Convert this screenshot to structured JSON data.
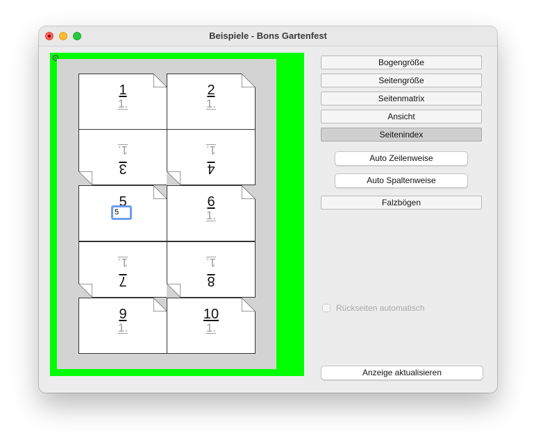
{
  "window": {
    "title": "Beispiele - Bons Gartenfest"
  },
  "preview": {
    "background_color": "#00ff00",
    "sheet_color": "#d3d3d3",
    "settings_icon": "gear-icon",
    "pages": [
      {
        "number": "1",
        "sub": "1.",
        "orientation": "up"
      },
      {
        "number": "2",
        "sub": "1.",
        "orientation": "up"
      },
      {
        "number": "3",
        "sub": "1.",
        "orientation": "down"
      },
      {
        "number": "4",
        "sub": "1.",
        "orientation": "down"
      },
      {
        "number": "5",
        "sub": "",
        "orientation": "up",
        "editing_value": "5"
      },
      {
        "number": "6",
        "sub": "1.",
        "orientation": "up"
      },
      {
        "number": "7",
        "sub": "1.",
        "orientation": "down"
      },
      {
        "number": "8",
        "sub": "1.",
        "orientation": "down"
      },
      {
        "number": "9",
        "sub": "1.",
        "orientation": "up"
      },
      {
        "number": "10",
        "sub": "1.",
        "orientation": "up"
      }
    ]
  },
  "sidebar": {
    "tabs": [
      {
        "label": "Bogengröße",
        "active": false
      },
      {
        "label": "Seitengröße",
        "active": false
      },
      {
        "label": "Seitenmatrix",
        "active": false
      },
      {
        "label": "Ansicht",
        "active": false
      },
      {
        "label": "Seitenindex",
        "active": true
      }
    ],
    "auto_rows_label": "Auto Zeilenweise",
    "auto_cols_label": "Auto Spaltenweise",
    "folding_label": "Falzbögen",
    "backsides_label": "Rückseiten automatisch",
    "backsides_checked": false,
    "backsides_enabled": false,
    "refresh_label": "Anzeige aktualisieren"
  }
}
